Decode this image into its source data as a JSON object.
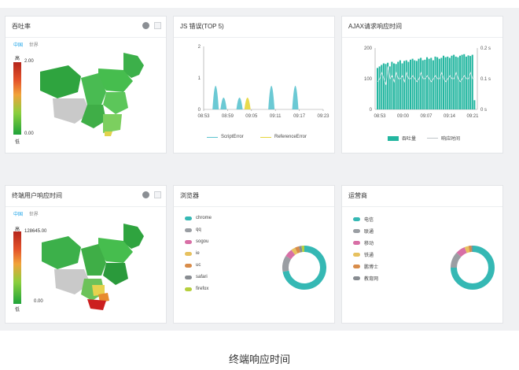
{
  "panels": {
    "throughput_map": {
      "title": "吞吐率",
      "tabs": [
        "中国",
        "世界"
      ],
      "legend_high": "高",
      "legend_low": "低",
      "max": "2.00",
      "min": "0.00"
    },
    "js_errors": {
      "title": "JS 错误(TOP 5)",
      "legend": [
        "ScriptError",
        "ReferenceError"
      ]
    },
    "ajax": {
      "title": "AJAX请求响应时间",
      "legend": [
        "吞吐量",
        "响应时间"
      ]
    },
    "terminal_map": {
      "title": "终端用户响应时间",
      "tabs": [
        "中国",
        "世界"
      ],
      "legend_high": "高",
      "legend_low": "低",
      "max": "128645.00",
      "min": "0.00"
    },
    "browser": {
      "title": "浏览器",
      "items": [
        "chrome",
        "qq",
        "sogou",
        "ie",
        "uc",
        "safari",
        "firefox"
      ],
      "colors": [
        "#35b8b4",
        "#9a9ea3",
        "#d86fa6",
        "#e7c15f",
        "#d88c4a",
        "#888c91",
        "#b6cf3d"
      ]
    },
    "operator": {
      "title": "运营商",
      "items": [
        "电信",
        "联通",
        "移动",
        "铁通",
        "鹏博士",
        "教育网"
      ],
      "colors": [
        "#35b8b4",
        "#9a9ea3",
        "#d86fa6",
        "#e7c15f",
        "#d88c4a",
        "#888c91"
      ]
    }
  },
  "caption": "终端响应时间",
  "chart_data": [
    {
      "type": "area",
      "title": "JS 错误(TOP 5)",
      "x_ticks": [
        "08:53",
        "08:59",
        "09:05",
        "09:11",
        "09:17",
        "09:23"
      ],
      "y_ticks": [
        "0",
        "1",
        "2"
      ],
      "ylim": [
        0,
        2
      ],
      "series": [
        {
          "name": "ScriptError",
          "color": "#5bc3cf",
          "peaks": [
            {
              "x": "08:56",
              "y": 1
            },
            {
              "x": "08:58",
              "y": 0.5
            },
            {
              "x": "09:02",
              "y": 0.5
            },
            {
              "x": "09:10",
              "y": 1
            },
            {
              "x": "09:16",
              "y": 1
            }
          ]
        },
        {
          "name": "ReferenceError",
          "color": "#e5d63a",
          "peaks": [
            {
              "x": "09:04",
              "y": 0.5
            }
          ]
        }
      ]
    },
    {
      "type": "bar",
      "title": "AJAX请求响应时间",
      "x_ticks": [
        "08:53",
        "09:00",
        "09:07",
        "09:14",
        "09:21"
      ],
      "y_left_ticks": [
        "0",
        "100",
        "200"
      ],
      "y_right_ticks": [
        "0 s",
        "0.1 s",
        "0.2 s"
      ],
      "ylim": [
        0,
        200
      ],
      "series": [
        {
          "name": "吞吐量",
          "color": "#23b6a0",
          "values": [
            135,
            140,
            145,
            150,
            148,
            152,
            140,
            155,
            150,
            148,
            155,
            160,
            150,
            158,
            160,
            155,
            162,
            165,
            160,
            158,
            165,
            168,
            160,
            162,
            170,
            165,
            168,
            160,
            172,
            170,
            165,
            168,
            175,
            170,
            172,
            168,
            175,
            178,
            172,
            170,
            175,
            178,
            180,
            172,
            176,
            174,
            178,
            30
          ]
        },
        {
          "name": "响应时间",
          "color": "#e8ecef",
          "values": [
            0.09,
            0.1,
            0.12,
            0.1,
            0.08,
            0.14,
            0.1,
            0.11,
            0.09,
            0.12,
            0.1,
            0.1,
            0.11,
            0.09,
            0.12,
            0.1,
            0.1,
            0.11,
            0.1,
            0.09,
            0.1,
            0.12,
            0.1,
            0.1,
            0.11,
            0.1,
            0.09,
            0.1,
            0.11,
            0.1,
            0.1,
            0.12,
            0.1,
            0.09,
            0.1,
            0.11,
            0.1,
            0.1,
            0.12,
            0.1,
            0.09,
            0.1,
            0.11,
            0.1,
            0.1,
            0.12,
            0.1,
            0.1
          ]
        }
      ]
    },
    {
      "type": "pie",
      "title": "浏览器",
      "labels": [
        "chrome",
        "qq",
        "sogou",
        "ie",
        "uc",
        "safari",
        "firefox"
      ],
      "values": [
        72,
        12,
        6,
        3,
        3,
        2,
        2
      ]
    },
    {
      "type": "pie",
      "title": "运营商",
      "labels": [
        "电信",
        "联通",
        "移动",
        "铁通",
        "鹏博士",
        "教育网"
      ],
      "values": [
        75,
        12,
        7,
        3,
        2,
        1
      ]
    }
  ]
}
